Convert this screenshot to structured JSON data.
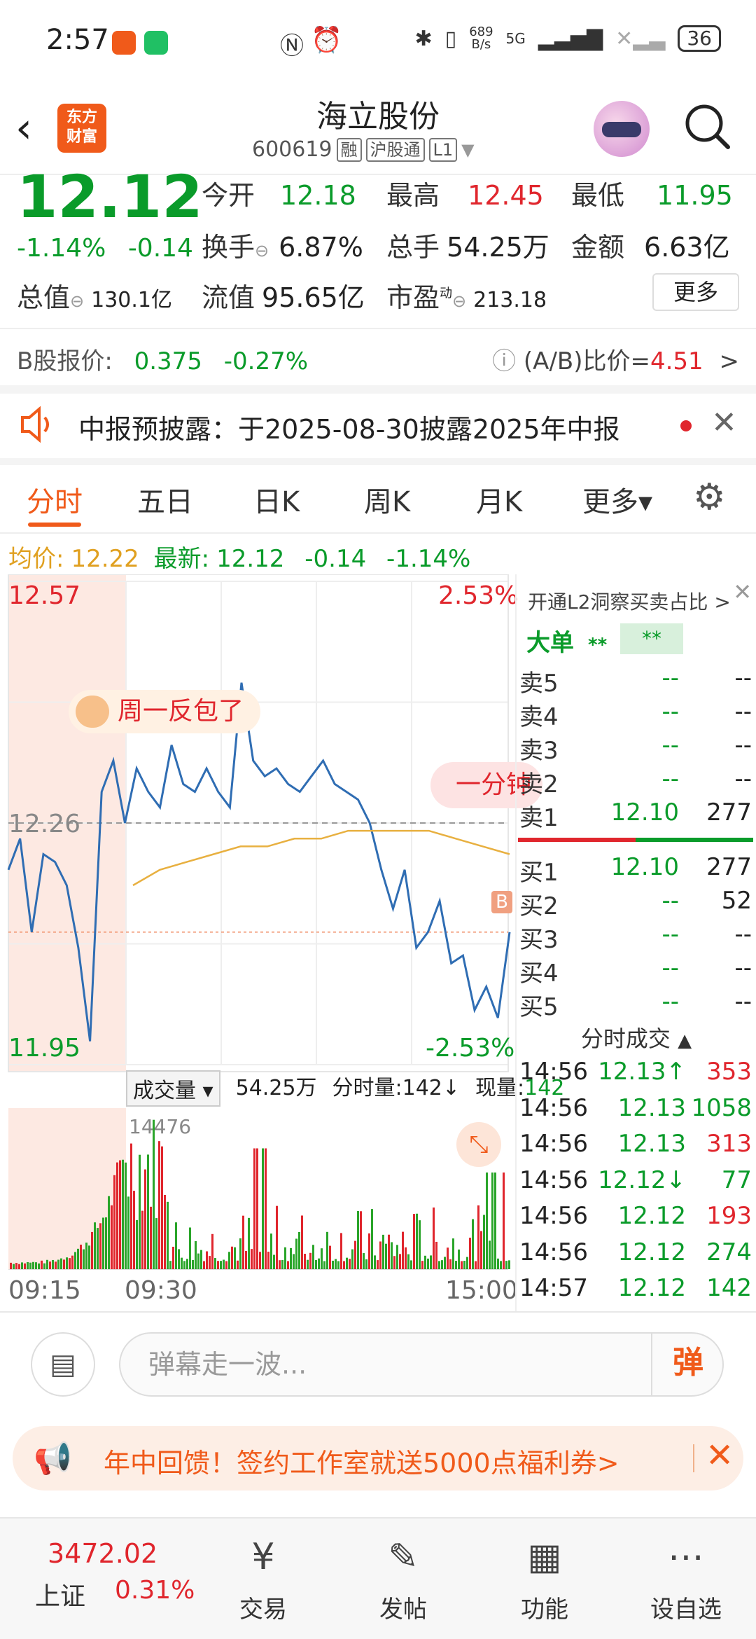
{
  "status_bar": {
    "time": "2:57",
    "net_speed_top": "689",
    "net_speed_bottom": "B/s",
    "network": "5G",
    "battery": "36"
  },
  "header": {
    "logo_text_line1": "东方",
    "logo_text_line2": "财富",
    "title": "海立股份",
    "code": "600619",
    "tags": [
      "融",
      "沪股通",
      "L1"
    ]
  },
  "quote": {
    "price": "12.12",
    "change_pct": "-1.14%",
    "change": "-0.14",
    "open_label": "今开",
    "open": "12.18",
    "high_label": "最高",
    "high": "12.45",
    "low_label": "最低",
    "low": "11.95",
    "turnover_label": "换手",
    "turnover": "6.87%",
    "volume_label": "总手",
    "volume": "54.25万",
    "amount_label": "金额",
    "amount": "6.63亿",
    "mktcap_label": "总值",
    "mktcap": "130.1亿",
    "float_label": "流值",
    "float": "95.65亿",
    "pe_label": "市盈",
    "pe_sup": "动",
    "pe": "213.18",
    "more_button": "更多"
  },
  "b_share": {
    "label": "B股报价:",
    "price": "0.375",
    "change": "-0.27%",
    "ratio_label": "(A/B)比价=",
    "ratio": "4.51",
    "arrow": ">"
  },
  "notice": {
    "text": "中报预披露：于2025-08-30披露2025年中报"
  },
  "tabs": {
    "items": [
      "分时",
      "五日",
      "日K",
      "周K",
      "月K",
      "更多▾"
    ]
  },
  "avg_line": {
    "avg_label": "均价:",
    "avg": "12.22",
    "latest_label": "最新:",
    "latest": "12.12",
    "chg": "-0.14",
    "chg_pct": "-1.14%"
  },
  "chart": {
    "y_high": "12.57",
    "y_mid": "12.26",
    "y_low": "11.95",
    "pct_high": "2.53%",
    "pct_low": "-2.53%",
    "danmu": "周一反包了",
    "bubble": "一分钟",
    "b_marker": "B",
    "vol_max": "14476",
    "x_labels": [
      "09:15",
      "09:30",
      "15:00"
    ]
  },
  "chart_data": {
    "type": "line",
    "title": "",
    "xlabel": "",
    "ylabel": "",
    "ylim": [
      11.95,
      12.57
    ],
    "x_range": [
      "09:15",
      "15:00"
    ],
    "reference_price": "12.26",
    "series": [
      {
        "name": "",
        "values": [
          12.2,
          12.24,
          12.12,
          12.22,
          12.21,
          12.18,
          12.1,
          11.98,
          12.3,
          12.34,
          12.26,
          12.33,
          12.3,
          12.28,
          12.36,
          12.31,
          12.3,
          12.33,
          12.3,
          12.28,
          12.44,
          12.34,
          12.32,
          12.33,
          12.31,
          12.3,
          12.32,
          12.34,
          12.31,
          12.3,
          12.29,
          12.26,
          12.2,
          12.15,
          12.2,
          12.1,
          12.12,
          12.16,
          12.08,
          12.09,
          12.02,
          12.05,
          12.01,
          12.12
        ]
      },
      {
        "name": "",
        "values": [
          12.18,
          12.2,
          12.21,
          12.22,
          12.23,
          12.23,
          12.24,
          12.24,
          12.25,
          12.25,
          12.25,
          12.25,
          12.24,
          12.23,
          12.22
        ]
      }
    ],
    "volume": {
      "max": 14476
    }
  },
  "vol_header": {
    "selector": "成交量",
    "total": "54.25万",
    "per_min_label": "分时量:",
    "per_min": "142↓",
    "now_label": "现量:",
    "now": "142"
  },
  "order_book": {
    "header": "开通L2洞察买卖占比 >",
    "big_order_label": "大单",
    "big_order_value": "**",
    "big_order_bar": "**",
    "asks": [
      {
        "name": "卖5",
        "price": "--",
        "vol": "--"
      },
      {
        "name": "卖4",
        "price": "--",
        "vol": "--"
      },
      {
        "name": "卖3",
        "price": "--",
        "vol": "--"
      },
      {
        "name": "卖2",
        "price": "--",
        "vol": "--"
      },
      {
        "name": "卖1",
        "price": "12.10",
        "vol": "277"
      }
    ],
    "bids": [
      {
        "name": "买1",
        "price": "12.10",
        "vol": "277"
      },
      {
        "name": "买2",
        "price": "--",
        "vol": "52"
      },
      {
        "name": "买3",
        "price": "--",
        "vol": "--"
      },
      {
        "name": "买4",
        "price": "--",
        "vol": "--"
      },
      {
        "name": "买5",
        "price": "--",
        "vol": "--"
      }
    ],
    "trades_title": "分时成交",
    "trades": [
      {
        "time": "14:56",
        "price": "12.13↑",
        "vol": "353"
      },
      {
        "time": "14:56",
        "price": "12.13",
        "vol": "1058"
      },
      {
        "time": "14:56",
        "price": "12.13",
        "vol": "313"
      },
      {
        "time": "14:56",
        "price": "12.12↓",
        "vol": "77"
      },
      {
        "time": "14:56",
        "price": "12.12",
        "vol": "193"
      },
      {
        "time": "14:56",
        "price": "12.12",
        "vol": "274"
      },
      {
        "time": "14:57",
        "price": "12.12",
        "vol": "142"
      }
    ]
  },
  "comment_bar": {
    "placeholder": "弹幕走一波...",
    "send": "弹"
  },
  "promo": {
    "text": "年中回馈！签约工作室就送5000点福利券>"
  },
  "nav": {
    "index_value": "3472.02",
    "index_name": "上证",
    "index_change": "0.31%",
    "items": [
      "交易",
      "发帖",
      "功能",
      "设自选"
    ]
  }
}
